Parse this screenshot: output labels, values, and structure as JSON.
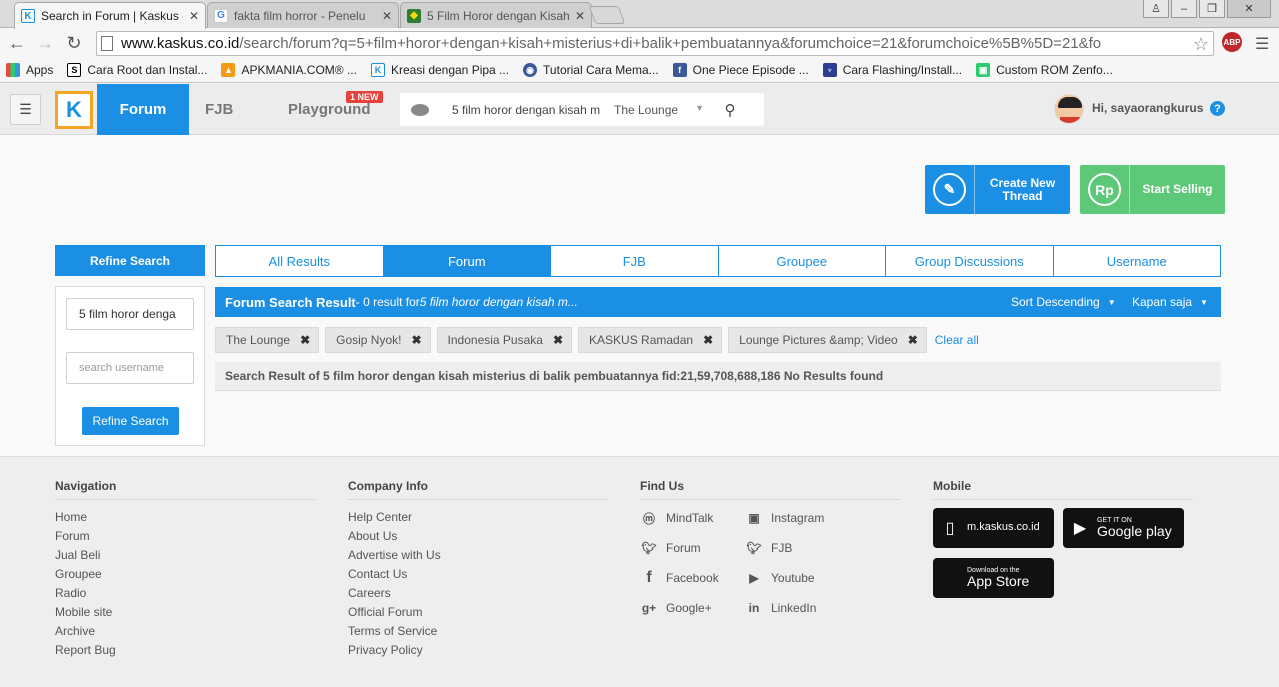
{
  "browser": {
    "tabs": [
      {
        "title": "Search in Forum | Kaskus -",
        "favicon": "kaskus-icon",
        "active": true
      },
      {
        "title": "fakta film horror - Penelu",
        "favicon": "google-icon",
        "active": false
      },
      {
        "title": "5 Film Horor dengan Kisah",
        "favicon": "kaskus-shield-icon",
        "active": false
      }
    ],
    "url_domain": "www.kaskus.co.id",
    "url_path": "/search/forum?q=5+film+horor+dengan+kisah+misterius+di+balik+pembuatannya&forumchoice=21&forumchoice%5B%5D=21&fo",
    "abp_label": "ABP",
    "bookmarks": [
      {
        "label": "Apps",
        "icon": "apps-grid-icon",
        "color": "#e74c3c"
      },
      {
        "label": "Cara Root dan Instal...",
        "icon": "s-icon",
        "color": "#000000"
      },
      {
        "label": "APKMANIA.COM® ...",
        "icon": "apkmania-icon",
        "color": "#f39c12"
      },
      {
        "label": "Kreasi dengan Pipa ...",
        "icon": "kaskus-icon",
        "color": "#1a8fe3"
      },
      {
        "label": "Tutorial Cara Mema...",
        "icon": "podcast-icon",
        "color": "#3b5998"
      },
      {
        "label": "One Piece Episode ...",
        "icon": "facebook-icon",
        "color": "#3b5998"
      },
      {
        "label": "Cara Flashing/Install...",
        "icon": "signal-icon",
        "color": "#2c3e91"
      },
      {
        "label": "Custom ROM Zenfo...",
        "icon": "android-icon",
        "color": "#2ecc71"
      }
    ]
  },
  "header": {
    "nav_forum": "Forum",
    "nav_fjb": "FJB",
    "nav_playground": "Playground",
    "new_badge": "1 NEW",
    "search_query": "5 film horor dengan kisah m",
    "search_scope": "The Lounge",
    "user_greeting": "Hi, sayaorangkurus",
    "help": "?"
  },
  "actions": {
    "create_thread": "Create New Thread",
    "start_selling": "Start Selling",
    "sell_icon_text": "Rp"
  },
  "refine": {
    "heading": "Refine Search",
    "query_value": "5 film horor denga",
    "username_placeholder": "search username",
    "button": "Refine Search"
  },
  "result_tabs": [
    {
      "label": "All Results",
      "active": false
    },
    {
      "label": "Forum",
      "active": true
    },
    {
      "label": "FJB",
      "active": false
    },
    {
      "label": "Groupee",
      "active": false
    },
    {
      "label": "Group Discussions",
      "active": false
    },
    {
      "label": "Username",
      "active": false
    }
  ],
  "result_bar": {
    "title": "Forum Search Result",
    "count_text": " - 0 result for ",
    "query": "5 film horor dengan kisah m...",
    "sort": "Sort Descending",
    "period": "Kapan saja"
  },
  "filters": [
    "The Lounge",
    "Gosip Nyok!",
    "Indonesia Pusaka",
    "KASKUS Ramadan",
    "Lounge Pictures &amp; Video"
  ],
  "clear_all": "Clear all",
  "no_results": "Search Result of 5 film horor dengan kisah misterius di balik pembuatannya fid:21,59,708,688,186 No Results found",
  "footer": {
    "navigation": {
      "heading": "Navigation",
      "links": [
        "Home",
        "Forum",
        "Jual Beli",
        "Groupee",
        "Radio",
        "Mobile site",
        "Archive",
        "Report Bug"
      ]
    },
    "company": {
      "heading": "Company Info",
      "links": [
        "Help Center",
        "About Us",
        "Advertise with Us",
        "Contact Us",
        "Careers",
        "Official Forum",
        "Terms of Service",
        "Privacy Policy"
      ]
    },
    "find_us": {
      "heading": "Find Us",
      "items": [
        {
          "label": "MindTalk",
          "icon": "mindtalk-icon"
        },
        {
          "label": "Instagram",
          "icon": "instagram-icon"
        },
        {
          "label": "Forum",
          "icon": "twitter-icon"
        },
        {
          "label": "FJB",
          "icon": "twitter-icon"
        },
        {
          "label": "Facebook",
          "icon": "facebook-icon"
        },
        {
          "label": "Youtube",
          "icon": "youtube-icon"
        },
        {
          "label": "Google+",
          "icon": "google-plus-icon"
        },
        {
          "label": "LinkedIn",
          "icon": "linkedin-icon"
        }
      ]
    },
    "mobile": {
      "heading": "Mobile",
      "mkaskus": "m.kaskus.co.id",
      "gplay_small": "GET IT ON",
      "gplay_big": "Google play",
      "appstore_small": "Download on the",
      "appstore_big": "App Store"
    }
  },
  "colors": {
    "accent": "#1a8fe3",
    "sell_green": "#5cc878",
    "logo_orange": "#f5a623"
  }
}
